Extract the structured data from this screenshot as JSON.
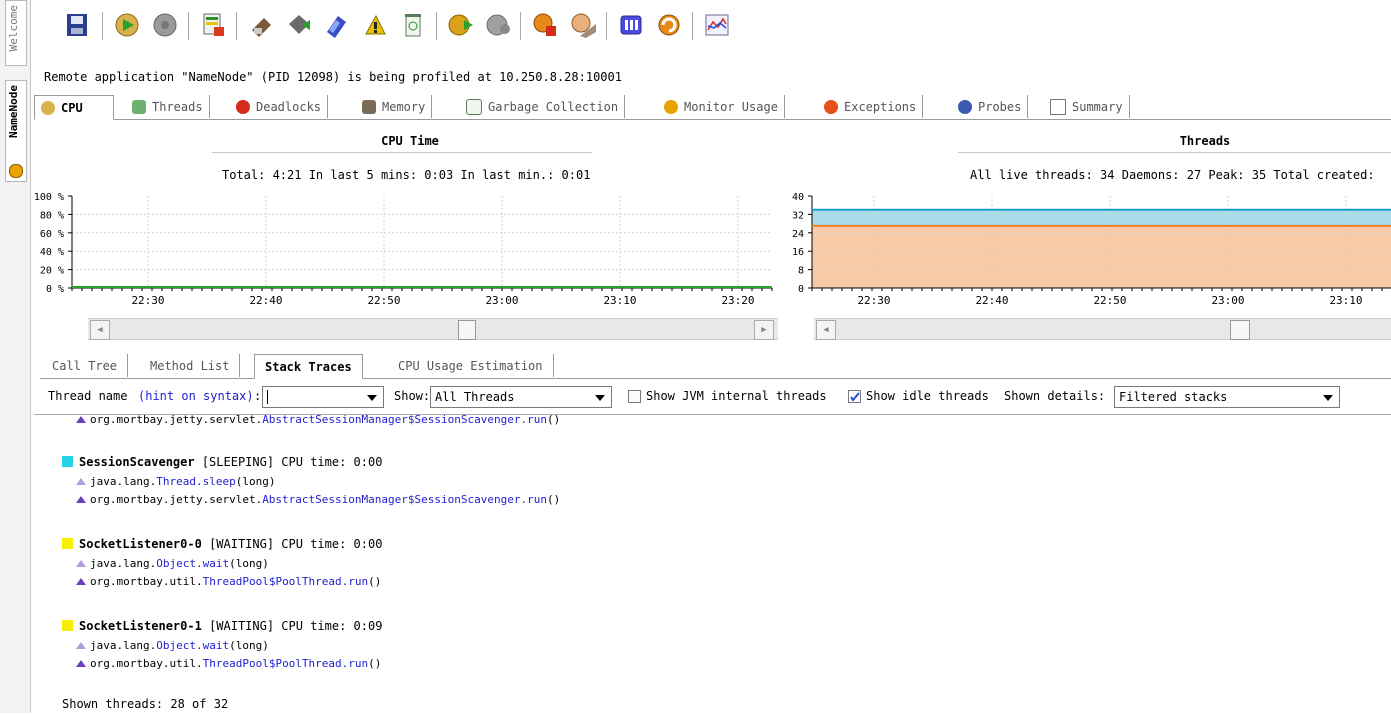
{
  "sidebar": {
    "tabs": [
      {
        "label": "Welcome"
      },
      {
        "label": "NameNode"
      }
    ]
  },
  "toolbar": {
    "icons": [
      "save-snapshot-icon",
      "start-cpu-icon",
      "stop-cpu-icon",
      "threads-monitor-icon",
      "run-gc-icon",
      "memory-icon",
      "heap-dump-icon",
      "thread-dump-icon",
      "trash-icon",
      "resume-icon",
      "pause-icon",
      "stop-icon",
      "reset-icon",
      "snapshot-icon",
      "refresh-icon",
      "telemetry-icon"
    ]
  },
  "message": "Remote application \"NameNode\" (PID 12098) is being profiled at 10.250.8.28:10001",
  "tabs": [
    {
      "label": "CPU",
      "active": true
    },
    {
      "label": "Threads"
    },
    {
      "label": "Deadlocks"
    },
    {
      "label": "Memory"
    },
    {
      "label": "Garbage Collection"
    },
    {
      "label": "Monitor Usage"
    },
    {
      "label": "Exceptions"
    },
    {
      "label": "Probes"
    },
    {
      "label": "Summary"
    }
  ],
  "cpu_panel": {
    "title": "CPU Time",
    "stats": "Total: 4:21  In last 5 mins: 0:03  In last min.: 0:01",
    "y_ticks": [
      "100 %",
      "80 %",
      "60 %",
      "40 %",
      "20 %",
      "0 %"
    ],
    "x_ticks": [
      "22:30",
      "22:40",
      "22:50",
      "23:00",
      "23:10",
      "23:20"
    ]
  },
  "threads_panel": {
    "title": "Threads",
    "stats": "All live threads: 34  Daemons: 27  Peak: 35  Total created:",
    "y_ticks": [
      "40",
      "32",
      "24",
      "16",
      "8",
      "0"
    ],
    "x_ticks": [
      "22:30",
      "22:40",
      "22:50",
      "23:00",
      "23:10"
    ],
    "live_threads": 34,
    "daemons": 27,
    "colors": {
      "live": "#a8dced",
      "daemons": "#f8cba6"
    }
  },
  "subtabs": [
    {
      "label": "Call Tree"
    },
    {
      "label": "Method List"
    },
    {
      "label": "Stack Traces",
      "active": true
    },
    {
      "label": "CPU Usage Estimation"
    }
  ],
  "filters": {
    "thread_name_label": "Thread name",
    "hint_link": "(hint on syntax)",
    "colon": ":",
    "thread_name_value": "",
    "show_label": "Show:",
    "show_value": "All Threads",
    "jvm_internal_label": "Show JVM internal threads",
    "jvm_internal_checked": false,
    "idle_label": "Show idle threads",
    "idle_checked": true,
    "details_label": "Shown details:",
    "details_value": "Filtered stacks"
  },
  "stack": {
    "partial_frame": {
      "prefix": "org.mortbay.jetty.servlet.",
      "cls": "AbstractSessionManager$SessionScavenger.run",
      "suffix": "()"
    },
    "threads": [
      {
        "name": "SessionScavenger",
        "state": "[SLEEPING] CPU time: 0:00",
        "color": "#28d2e6",
        "frames": [
          {
            "prefix": "java.lang.",
            "cls": "Thread.sleep",
            "suffix": "(long)",
            "hollow": true
          },
          {
            "prefix": "org.mortbay.jetty.servlet.",
            "cls": "AbstractSessionManager$SessionScavenger.run",
            "suffix": "()",
            "hollow": false
          }
        ]
      },
      {
        "name": "SocketListener0-0",
        "state": "[WAITING] CPU time: 0:00",
        "color": "#f6f000",
        "frames": [
          {
            "prefix": "java.lang.",
            "cls": "Object.wait",
            "suffix": "(long)",
            "hollow": true
          },
          {
            "prefix": "org.mortbay.util.",
            "cls": "ThreadPool$PoolThread.run",
            "suffix": "()",
            "hollow": false
          }
        ]
      },
      {
        "name": "SocketListener0-1",
        "state": "[WAITING] CPU time: 0:09",
        "color": "#f6f000",
        "frames": [
          {
            "prefix": "java.lang.",
            "cls": "Object.wait",
            "suffix": "(long)",
            "hollow": true
          },
          {
            "prefix": "org.mortbay.util.",
            "cls": "ThreadPool$PoolThread.run",
            "suffix": "()",
            "hollow": false
          }
        ]
      }
    ],
    "footer": "Shown threads: 28 of 32"
  }
}
